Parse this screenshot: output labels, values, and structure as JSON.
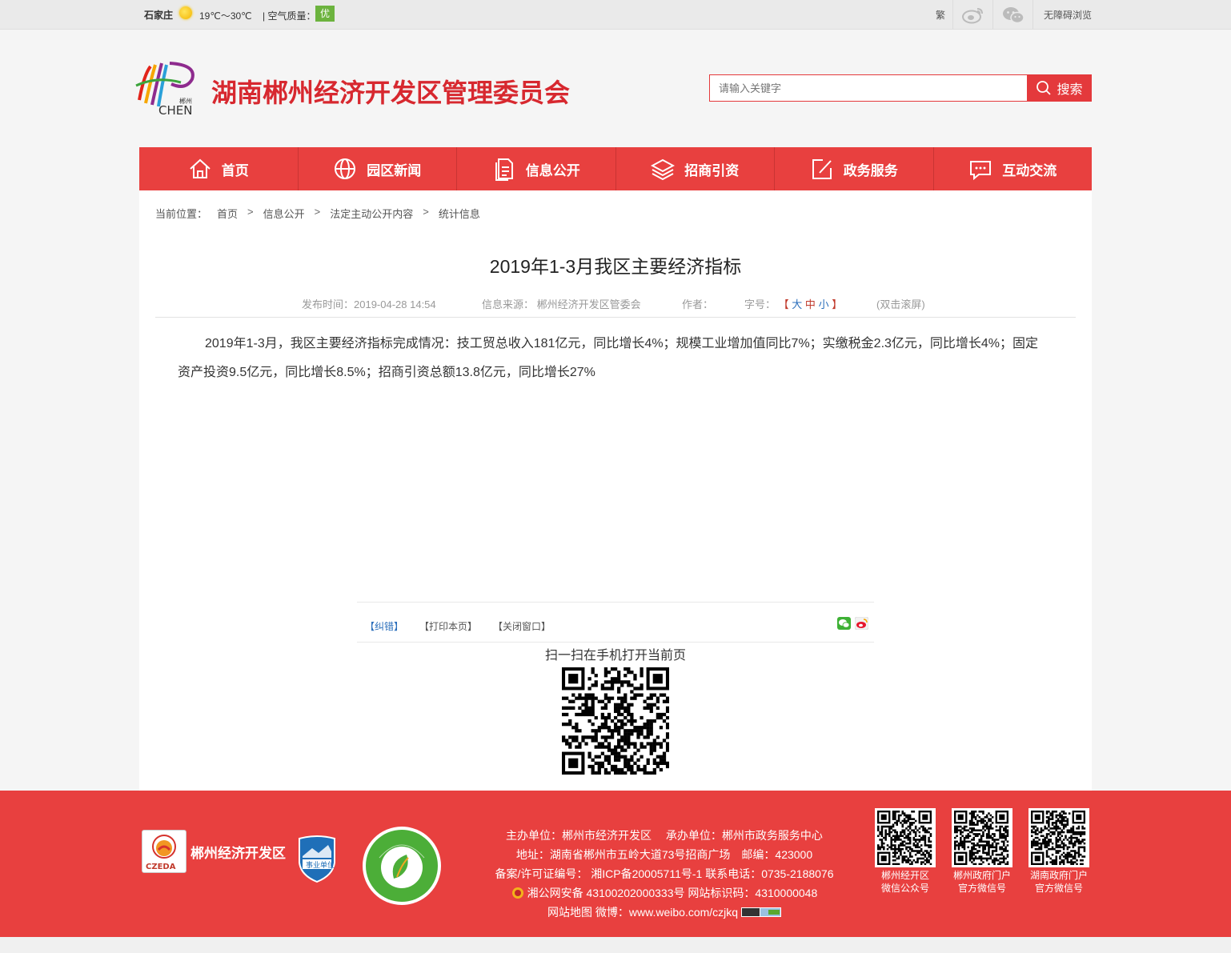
{
  "topbar": {
    "city": "石家庄",
    "weather_icon": "sun-icon",
    "temperature": "19℃～30℃",
    "air_quality_label": "空气质量：",
    "air_quality_value": "优",
    "traditional": "繁",
    "accessibility": "无障碍浏览"
  },
  "header": {
    "logo_text": "CHEN",
    "logo_city": "郴州",
    "site_title": "湖南郴州经济开发区管理委员会",
    "search_placeholder": "请输入关键字",
    "search_button": "搜索"
  },
  "nav": [
    {
      "label": "首页",
      "icon": "home-icon"
    },
    {
      "label": "园区新闻",
      "icon": "globe-icon"
    },
    {
      "label": "信息公开",
      "icon": "document-icon"
    },
    {
      "label": "招商引资",
      "icon": "layers-icon"
    },
    {
      "label": "政务服务",
      "icon": "edit-icon"
    },
    {
      "label": "互动交流",
      "icon": "chat-icon"
    }
  ],
  "breadcrumb": {
    "label": "当前位置：",
    "items": [
      "首页",
      "信息公开",
      "法定主动公开内容",
      "统计信息"
    ],
    "separator": ">"
  },
  "article": {
    "title": "2019年1-3月我区主要经济指标",
    "publish_time": "发布时间：2019-04-28 14:54",
    "source": "信息来源： 郴州经济开发区管委会",
    "author": "作者：",
    "font_label": "字号：",
    "font_open": "【",
    "font_large": "大",
    "font_medium": "中",
    "font_small": "小",
    "font_close": "】",
    "scroll": "(双击滚屏)",
    "body": "2019年1-3月，我区主要经济指标完成情况：技工贸总收入181亿元，同比增长4%；规模工业增加值同比7%；实缴税金2.3亿元，同比增长4%；固定资产投资9.5亿元，同比增长8.5%；招商引资总额13.8亿元，同比增长27%"
  },
  "tools": {
    "correct": "【纠错】",
    "print": "【打印本页】",
    "close": "【关闭窗口】",
    "qr_caption": "扫一扫在手机打开当前页"
  },
  "footer": {
    "badge_text": "CZEDA",
    "org_name": "郴州经济开发区",
    "shield_text": "事业单位",
    "lines": [
      "主办单位：郴州市经济开发区　 承办单位：郴州市政务服务中心",
      "地址：湖南省郴州市五岭大道73号招商广场　邮编：423000",
      "备案/许可证编号：  湘ICP备20005711号-1 联系电话：0735-2188076",
      "湘公网安备 43100202000333号 网站标识码：4310000048",
      "网站地图 微博：www.weibo.com/czjkq"
    ],
    "qrcodes": [
      {
        "line1": "郴州经开区",
        "line2": "微信公众号"
      },
      {
        "line1": "郴州政府门户",
        "line2": "官方微信号"
      },
      {
        "line1": "湖南政府门户",
        "line2": "官方微信号"
      }
    ]
  }
}
